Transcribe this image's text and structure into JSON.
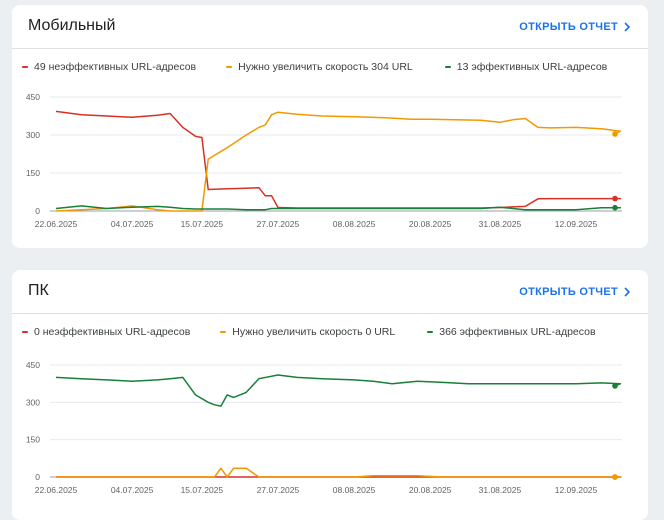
{
  "cards": [
    {
      "title": "Мобильный",
      "open_link": "ОТКРЫТЬ ОТЧЕТ",
      "legend": [
        {
          "label": "49 неэффективных URL-адресов",
          "color": "#d93025"
        },
        {
          "label": "Нужно увеличить скорость 304 URL",
          "color": "#f29900"
        },
        {
          "label": "13 эффективных URL-адресов",
          "color": "#188038"
        }
      ]
    },
    {
      "title": "ПК",
      "open_link": "ОТКРЫТЬ ОТЧЕТ",
      "legend": [
        {
          "label": "0 неэффективных URL-адресов",
          "color": "#d93025"
        },
        {
          "label": "Нужно увеличить скорость 0 URL",
          "color": "#f29900"
        },
        {
          "label": "366 эффективных URL-адресов",
          "color": "#188038"
        }
      ]
    }
  ],
  "chart_data": [
    {
      "type": "line",
      "title": "Мобильный",
      "x_ticks": [
        "22.06.2025",
        "04.07.2025",
        "15.07.2025",
        "27.07.2025",
        "08.08.2025",
        "20.08.2025",
        "31.08.2025",
        "12.09.2025"
      ],
      "y_ticks": [
        0,
        150,
        300,
        450
      ],
      "ylim": [
        0,
        450
      ],
      "grid": true,
      "x_dates": [
        "2025-06-22",
        "2025-06-26",
        "2025-06-30",
        "2025-07-04",
        "2025-07-08",
        "2025-07-10",
        "2025-07-12",
        "2025-07-14",
        "2025-07-15",
        "2025-07-16",
        "2025-07-19",
        "2025-07-22",
        "2025-07-24",
        "2025-07-25",
        "2025-07-26",
        "2025-07-27",
        "2025-07-30",
        "2025-08-03",
        "2025-08-08",
        "2025-08-13",
        "2025-08-17",
        "2025-08-20",
        "2025-08-24",
        "2025-08-28",
        "2025-08-31",
        "2025-09-02",
        "2025-09-04",
        "2025-09-06",
        "2025-09-08",
        "2025-09-12",
        "2025-09-16",
        "2025-09-19",
        "2025-09-21"
      ],
      "series": [
        {
          "name": "49 неэффективных URL-адресов",
          "color": "#d93025",
          "values": [
            393,
            380,
            375,
            370,
            378,
            385,
            330,
            295,
            290,
            85,
            88,
            90,
            92,
            60,
            60,
            14,
            12,
            12,
            12,
            12,
            12,
            12,
            12,
            12,
            14,
            16,
            18,
            48,
            49,
            49,
            49,
            49,
            49
          ]
        },
        {
          "name": "Нужно увеличить скорость 304 URL",
          "color": "#f29900",
          "values": [
            0,
            5,
            10,
            20,
            5,
            0,
            0,
            0,
            0,
            205,
            250,
            300,
            330,
            340,
            380,
            390,
            382,
            375,
            372,
            368,
            362,
            362,
            360,
            358,
            350,
            360,
            365,
            330,
            328,
            330,
            325,
            315,
            304
          ]
        },
        {
          "name": "13 эффективных URL-адресов",
          "color": "#188038",
          "values": [
            10,
            20,
            10,
            15,
            18,
            15,
            10,
            8,
            8,
            8,
            8,
            5,
            5,
            5,
            10,
            10,
            10,
            10,
            10,
            10,
            10,
            10,
            10,
            10,
            15,
            10,
            5,
            5,
            5,
            5,
            13,
            13,
            13
          ]
        }
      ]
    },
    {
      "type": "line",
      "title": "ПК",
      "x_ticks": [
        "22.06.2025",
        "04.07.2025",
        "15.07.2025",
        "27.07.2025",
        "08.08.2025",
        "20.08.2025",
        "31.08.2025",
        "12.09.2025"
      ],
      "y_ticks": [
        0,
        150,
        300,
        450
      ],
      "ylim": [
        0,
        450
      ],
      "grid": true,
      "x_dates": [
        "2025-06-22",
        "2025-06-26",
        "2025-06-30",
        "2025-07-04",
        "2025-07-08",
        "2025-07-10",
        "2025-07-12",
        "2025-07-14",
        "2025-07-16",
        "2025-07-17",
        "2025-07-18",
        "2025-07-19",
        "2025-07-20",
        "2025-07-22",
        "2025-07-24",
        "2025-07-27",
        "2025-07-30",
        "2025-08-03",
        "2025-08-08",
        "2025-08-11",
        "2025-08-14",
        "2025-08-18",
        "2025-08-22",
        "2025-08-26",
        "2025-08-31",
        "2025-09-04",
        "2025-09-08",
        "2025-09-12",
        "2025-09-16",
        "2025-09-19",
        "2025-09-21"
      ],
      "series": [
        {
          "name": "0 неэффективных URL-адресов",
          "color": "#d93025",
          "values": [
            0,
            0,
            0,
            0,
            0,
            0,
            0,
            0,
            0,
            0,
            0,
            0,
            0,
            0,
            0,
            0,
            0,
            0,
            0,
            0,
            0,
            0,
            0,
            0,
            0,
            0,
            0,
            0,
            0,
            0,
            0
          ]
        },
        {
          "name": "Нужно увеличить скорость 0 URL",
          "color": "#f29900",
          "values": [
            0,
            0,
            0,
            0,
            0,
            0,
            0,
            0,
            0,
            0,
            35,
            0,
            35,
            35,
            0,
            0,
            0,
            0,
            0,
            5,
            5,
            5,
            0,
            0,
            0,
            0,
            0,
            0,
            0,
            0,
            0
          ]
        },
        {
          "name": "366 эффективных URL-адресов",
          "color": "#188038",
          "values": [
            400,
            395,
            390,
            385,
            390,
            395,
            400,
            330,
            300,
            290,
            285,
            330,
            320,
            340,
            395,
            410,
            400,
            395,
            390,
            385,
            375,
            385,
            380,
            375,
            375,
            375,
            375,
            375,
            378,
            375,
            366
          ]
        }
      ]
    }
  ]
}
